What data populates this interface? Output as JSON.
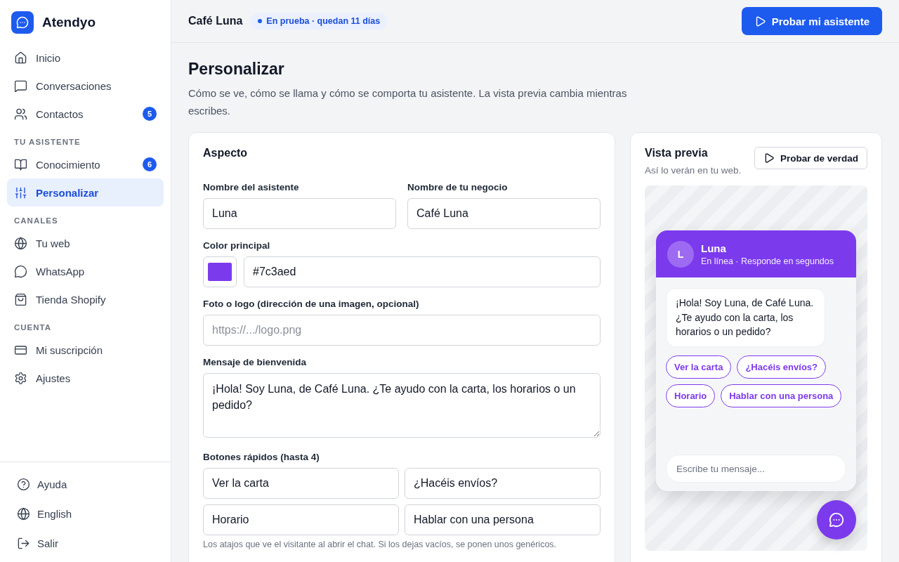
{
  "brand": {
    "name": "Atendyo"
  },
  "sidebar": {
    "sections": [
      {
        "items": [
          {
            "label": "Inicio",
            "selected": false
          },
          {
            "label": "Conversaciones",
            "selected": false
          },
          {
            "label": "Contactos",
            "badge": "5",
            "selected": false
          }
        ]
      },
      {
        "heading": "TU ASISTENTE",
        "items": [
          {
            "label": "Conocimiento",
            "badge": "6",
            "selected": false
          },
          {
            "label": "Personalizar",
            "selected": true
          }
        ]
      },
      {
        "heading": "CANALES",
        "items": [
          {
            "label": "Tu web",
            "selected": false
          },
          {
            "label": "WhatsApp",
            "selected": false
          },
          {
            "label": "Tienda Shopify",
            "selected": false
          }
        ]
      },
      {
        "heading": "CUENTA",
        "items": [
          {
            "label": "Mi suscripción",
            "selected": false
          },
          {
            "label": "Ajustes",
            "selected": false
          }
        ]
      }
    ],
    "footer": [
      {
        "label": "Ayuda"
      },
      {
        "label": "English"
      },
      {
        "label": "Salir"
      }
    ]
  },
  "header": {
    "business": "Café Luna",
    "status": "En prueba · quedan 11 días",
    "button": "Probar mi asistente"
  },
  "page": {
    "title": "Personalizar",
    "description": "Cómo se ve, cómo se llama y cómo se comporta tu asistente. La vista previa cambia mientras escribes."
  },
  "aspect": {
    "title": "Aspecto",
    "assistant_name": {
      "label": "Nombre del asistente",
      "value": "Luna"
    },
    "business_name": {
      "label": "Nombre de tu negocio",
      "value": "Café Luna"
    },
    "main_color": {
      "label": "Color principal",
      "value": "#7c3aed"
    },
    "logo": {
      "label": "Foto o logo (dirección de una imagen, opcional)",
      "placeholder": "https://.../logo.png"
    },
    "welcome": {
      "label": "Mensaje de bienvenida",
      "value": "¡Hola! Soy Luna, de Café Luna. ¿Te ayudo con la carta, los horarios o un pedido?"
    },
    "quick_buttons": {
      "label": "Botones rápidos (hasta 4)",
      "values": [
        "Ver la carta",
        "¿Hacéis envíos?",
        "Horario",
        "Hablar con una persona"
      ],
      "hint": "Los atajos que ve el visitante al abrir el chat. Si los dejas vacíos, se ponen unos genéricos."
    }
  },
  "preview": {
    "title": "Vista previa",
    "subtitle": "Así lo verán en tu web.",
    "button": "Probar de verdad",
    "chat": {
      "avatar": "L",
      "name": "Luna",
      "status": "En línea · Responde en segundos",
      "message": "¡Hola! Soy Luna, de Café Luna. ¿Te ayudo con la carta, los horarios o un pedido?",
      "chips": [
        "Ver la carta",
        "¿Hacéis envíos?",
        "Horario",
        "Hablar con una persona"
      ],
      "input_placeholder": "Escribe tu mensaje..."
    }
  }
}
